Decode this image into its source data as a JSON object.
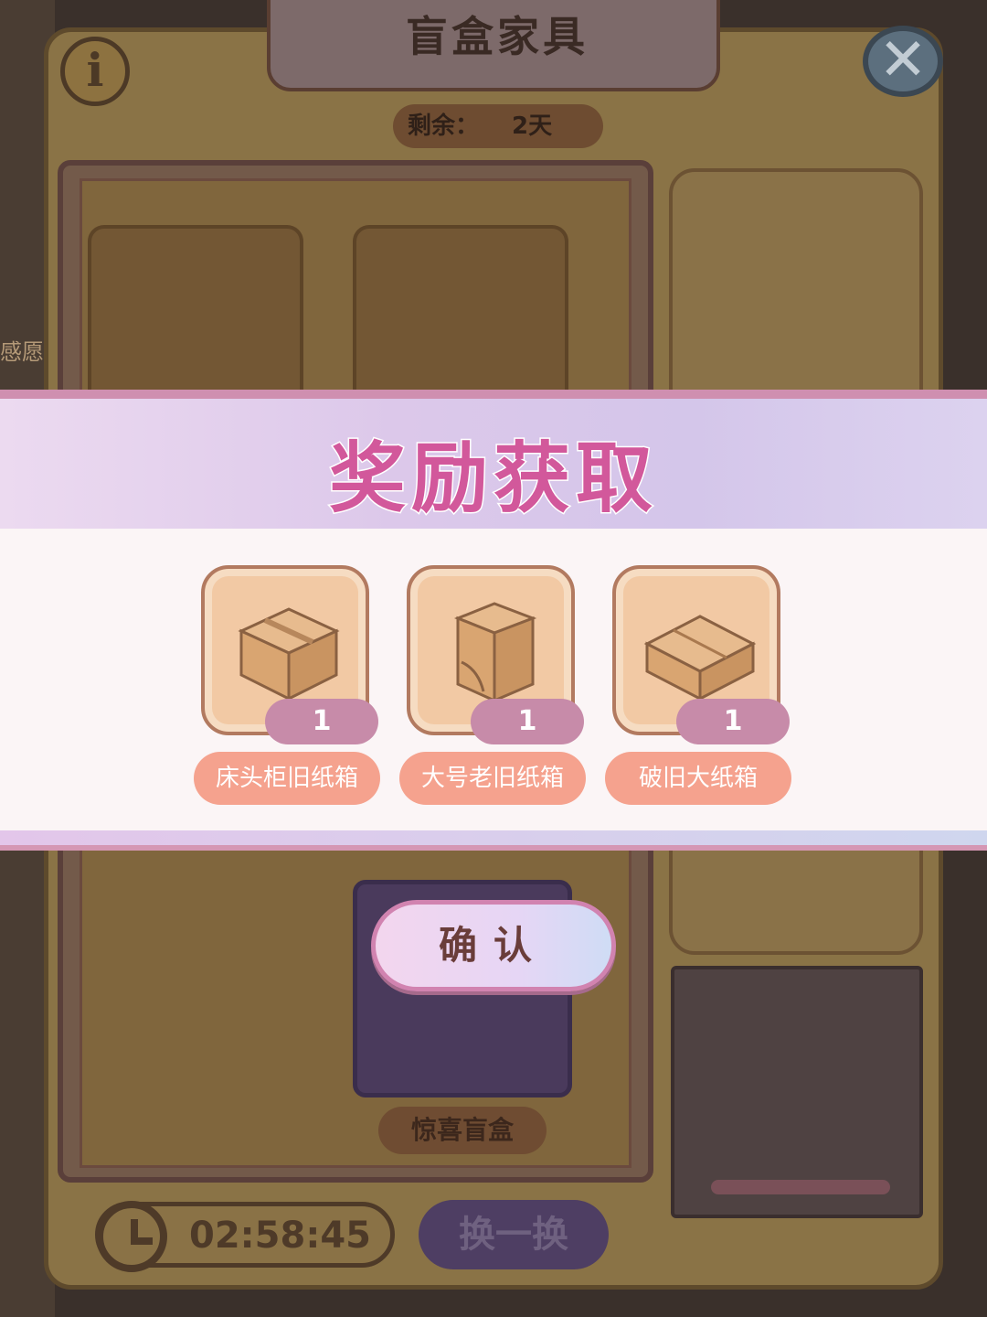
{
  "dialog": {
    "title": "盲盒家具",
    "remaining_label": "剩余：",
    "remaining_value": "2天"
  },
  "background": {
    "side_label": "感愿",
    "blind_box_label": "惊喜盲盒",
    "timer": "02:58:45",
    "swap_label": "换一换"
  },
  "reward": {
    "title": "奖励获取",
    "items": [
      {
        "name": "床头柜旧纸箱",
        "quantity": "1",
        "icon": "cardboard-box-icon"
      },
      {
        "name": "大号老旧纸箱",
        "quantity": "1",
        "icon": "tall-cardboard-box-icon"
      },
      {
        "name": "破旧大纸箱",
        "quantity": "1",
        "icon": "flat-cardboard-box-icon"
      }
    ],
    "confirm_label": "确认"
  },
  "colors": {
    "reward_title": "#d2589b",
    "item_name_bg": "#f5a28e",
    "quantity_badge": "#c78ba9",
    "confirm_border": "#d183b0"
  }
}
